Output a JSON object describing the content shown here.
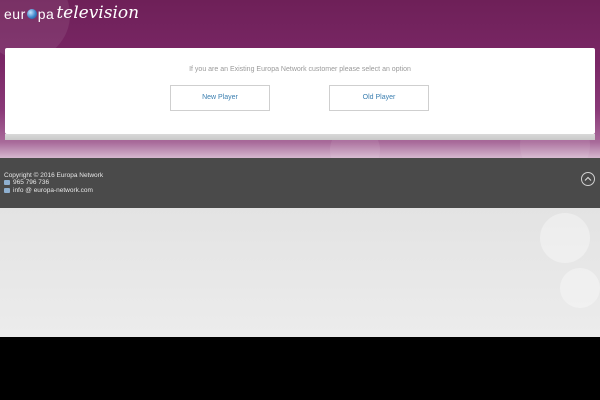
{
  "logo": {
    "part1": "eur",
    "part2": "pa",
    "part3": "television"
  },
  "selection": {
    "prompt": "If you are an Existing Europa Network customer please select an option",
    "new_player": "New Player",
    "old_player": "Old Player"
  },
  "footer": {
    "copyright": "Copyright © 2016 Europa Network",
    "phone": "965 796 736",
    "email": "info @ europa-network.com"
  },
  "icons": {
    "globe": "globe-icon",
    "phone": "phone-icon",
    "mail": "mail-icon",
    "scroll_top": "chevron-up-icon"
  },
  "colors": {
    "brand_purple": "#7a2766",
    "link_blue": "#3b7fb0",
    "footer_bg": "#4a4a4a"
  }
}
